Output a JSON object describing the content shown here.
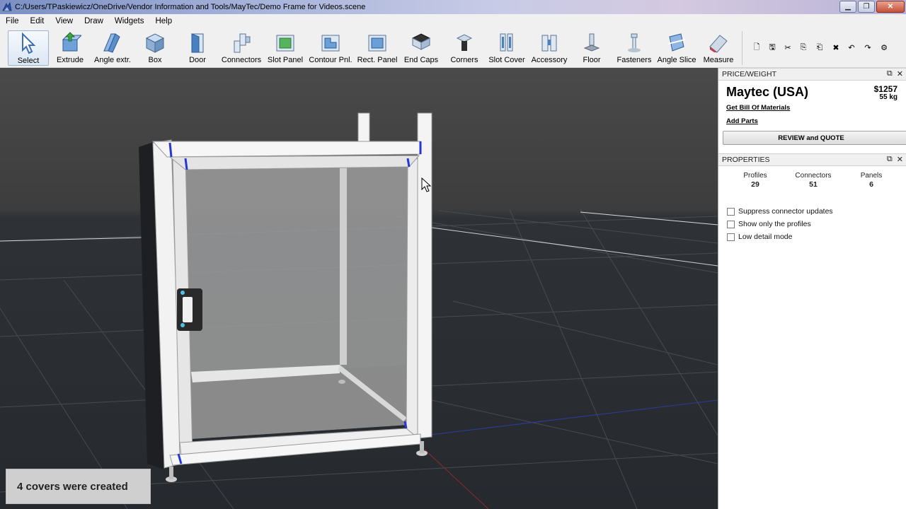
{
  "window": {
    "title": "C:/Users/TPaskiewicz/OneDrive/Vendor Information and Tools/MayTec/Demo Frame for Videos.scene",
    "minimize_glyph": "▁",
    "maximize_glyph": "❐",
    "close_glyph": "✕"
  },
  "menu": [
    "File",
    "Edit",
    "View",
    "Draw",
    "Widgets",
    "Help"
  ],
  "toolbar": {
    "tools": [
      {
        "label": "Select",
        "icon": "cursor-icon"
      },
      {
        "label": "Extrude",
        "icon": "extrude-icon"
      },
      {
        "label": "Angle extr.",
        "icon": "angle-extrude-icon"
      },
      {
        "label": "Box",
        "icon": "box-icon"
      },
      {
        "label": "Door",
        "icon": "door-icon"
      },
      {
        "label": "Connectors",
        "icon": "connectors-icon"
      },
      {
        "label": "Slot Panel",
        "icon": "slot-panel-icon"
      },
      {
        "label": "Contour Pnl.",
        "icon": "contour-panel-icon"
      },
      {
        "label": "Rect. Panel",
        "icon": "rect-panel-icon"
      },
      {
        "label": "End Caps",
        "icon": "end-caps-icon"
      },
      {
        "label": "Corners",
        "icon": "corners-icon"
      },
      {
        "label": "Slot Cover",
        "icon": "slot-cover-icon"
      },
      {
        "label": "Accessory",
        "icon": "accessory-icon"
      },
      {
        "label": "Floor",
        "icon": "floor-icon"
      },
      {
        "label": "Fasteners",
        "icon": "fasteners-icon"
      },
      {
        "label": "Angle Slice",
        "icon": "angle-slice-icon"
      },
      {
        "label": "Measure",
        "icon": "measure-icon"
      }
    ],
    "quick_actions": [
      {
        "icon": "new-file-icon",
        "glyph": "🗋"
      },
      {
        "icon": "save-icon",
        "glyph": "🖫"
      },
      {
        "icon": "cut-icon",
        "glyph": "✂"
      },
      {
        "icon": "copy-icon",
        "glyph": "⎘"
      },
      {
        "icon": "paste-icon",
        "glyph": "⎗"
      },
      {
        "icon": "delete-icon",
        "glyph": "✖"
      },
      {
        "icon": "undo-icon",
        "glyph": "↶"
      },
      {
        "icon": "redo-icon",
        "glyph": "↷"
      },
      {
        "icon": "settings-icon",
        "glyph": "⚙"
      }
    ]
  },
  "viewport": {
    "notification": "4 covers were created"
  },
  "price_panel": {
    "header": "PRICE/WEIGHT",
    "vendor": "Maytec (USA)",
    "price": "$1257",
    "weight": "55 kg",
    "bom_link": "Get Bill Of Materials",
    "add_parts_link": "Add Parts",
    "review_button": "REVIEW and QUOTE"
  },
  "properties_panel": {
    "header": "PROPERTIES",
    "stats": [
      {
        "label": "Profiles",
        "value": "29"
      },
      {
        "label": "Connectors",
        "value": "51"
      },
      {
        "label": "Panels",
        "value": "6"
      }
    ],
    "options": [
      {
        "label": "Suppress connector updates",
        "checked": false
      },
      {
        "label": "Show only the profiles",
        "checked": false
      },
      {
        "label": "Low detail mode",
        "checked": false
      }
    ]
  },
  "panel_buttons": {
    "float": "⧉",
    "close": "✕"
  }
}
